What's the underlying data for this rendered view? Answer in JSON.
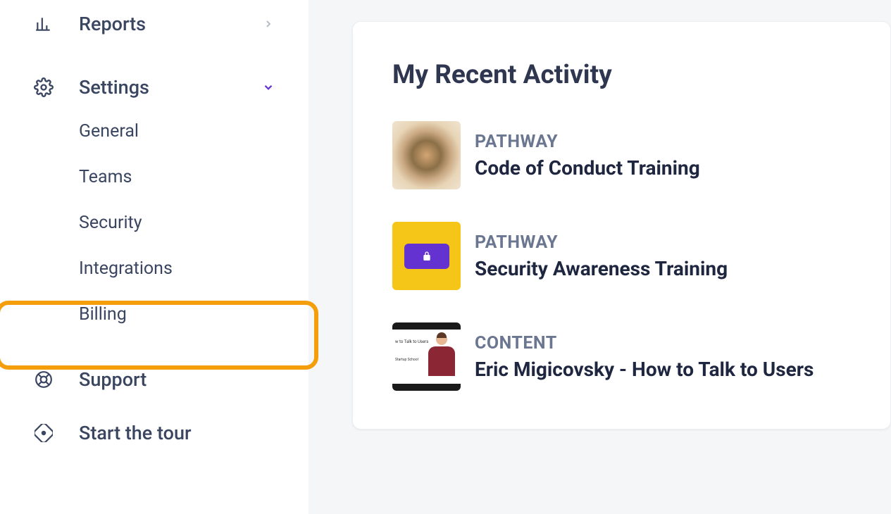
{
  "sidebar": {
    "reports": "Reports",
    "settings": "Settings",
    "sub": {
      "general": "General",
      "teams": "Teams",
      "security": "Security",
      "integrations": "Integrations",
      "billing": "Billing"
    },
    "support": "Support",
    "tour": "Start the tour"
  },
  "main": {
    "title": "My Recent Activity",
    "items": [
      {
        "type": "PATHWAY",
        "title": "Code of Conduct Training"
      },
      {
        "type": "PATHWAY",
        "title": "Security Awareness Training"
      },
      {
        "type": "CONTENT",
        "title": "Eric Migicovsky - How to Talk to Users"
      }
    ]
  },
  "thumb3": {
    "line1": "w to Talk to Users",
    "line2": "Startup School"
  }
}
